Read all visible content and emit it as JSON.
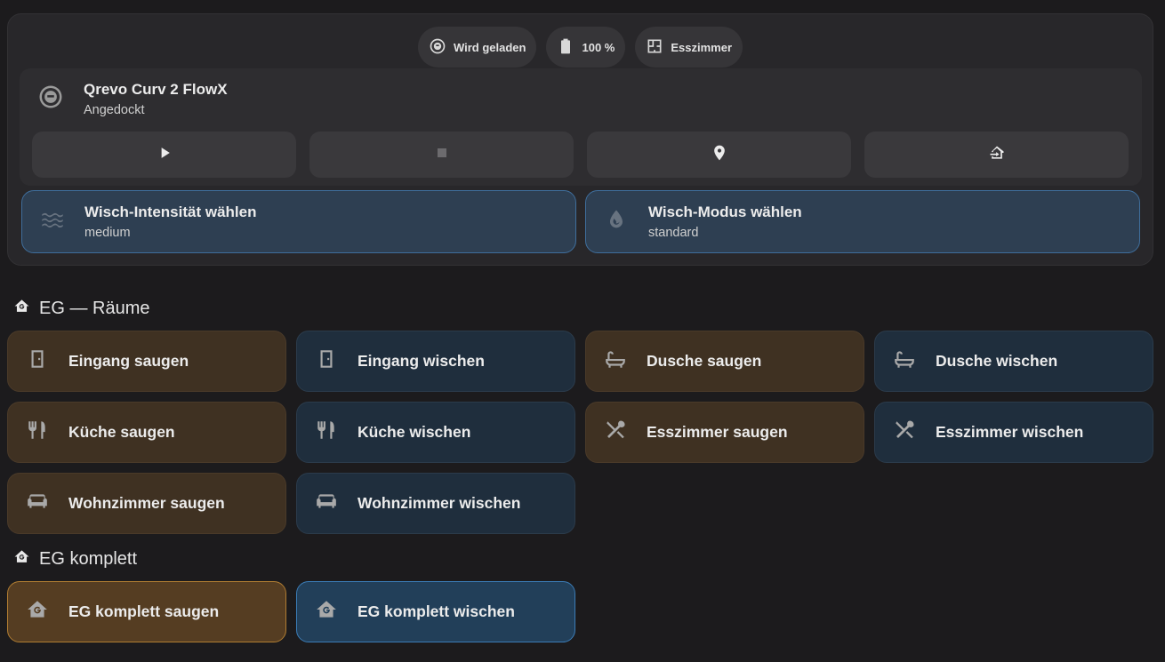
{
  "status_chips": [
    {
      "icon": "robot-vacuum-icon",
      "label": "Wird geladen"
    },
    {
      "icon": "battery-full-icon",
      "label": "100 %"
    },
    {
      "icon": "floor-plan-icon",
      "label": "Esszimmer"
    }
  ],
  "vacuum": {
    "name": "Qrevo Curv 2 FlowX",
    "state": "Angedockt",
    "controls": [
      {
        "icon": "play-icon",
        "name": "start"
      },
      {
        "icon": "stop-icon",
        "name": "stop"
      },
      {
        "icon": "locate-icon",
        "name": "locate"
      },
      {
        "icon": "return-home-icon",
        "name": "return-home"
      }
    ]
  },
  "selects": [
    {
      "icon": "waves-icon",
      "label": "Wisch-Intensität wählen",
      "value": "medium"
    },
    {
      "icon": "water-drop-icon",
      "label": "Wisch-Modus wählen",
      "value": "standard"
    }
  ],
  "sections": {
    "rooms_title": "EG — Räume",
    "complete_title": "EG komplett"
  },
  "room_tiles": [
    {
      "label": "Eingang saugen",
      "mode": "saugen",
      "icon": "door-icon"
    },
    {
      "label": "Eingang wischen",
      "mode": "wischen",
      "icon": "door-icon"
    },
    {
      "label": "Dusche saugen",
      "mode": "saugen",
      "icon": "bathtub-icon"
    },
    {
      "label": "Dusche wischen",
      "mode": "wischen",
      "icon": "bathtub-icon"
    },
    {
      "label": "Küche saugen",
      "mode": "saugen",
      "icon": "fork-knife-icon"
    },
    {
      "label": "Küche wischen",
      "mode": "wischen",
      "icon": "fork-knife-icon"
    },
    {
      "label": "Esszimmer saugen",
      "mode": "saugen",
      "icon": "silverware-cross-icon"
    },
    {
      "label": "Esszimmer wischen",
      "mode": "wischen",
      "icon": "silverware-cross-icon"
    },
    {
      "label": "Wohnzimmer saugen",
      "mode": "saugen",
      "icon": "sofa-icon"
    },
    {
      "label": "Wohnzimmer wischen",
      "mode": "wischen",
      "icon": "sofa-icon"
    }
  ],
  "complete_tiles": [
    {
      "label": "EG komplett saugen",
      "mode": "saugen",
      "icon": "home-g-icon"
    },
    {
      "label": "EG komplett wischen",
      "mode": "wischen",
      "icon": "home-g-icon"
    }
  ],
  "colors": {
    "background": "#1c1b1d",
    "saugen_tile": "#3f3122",
    "wischen_tile": "#1f2e3d",
    "select_accent": "#3f6e9c"
  }
}
